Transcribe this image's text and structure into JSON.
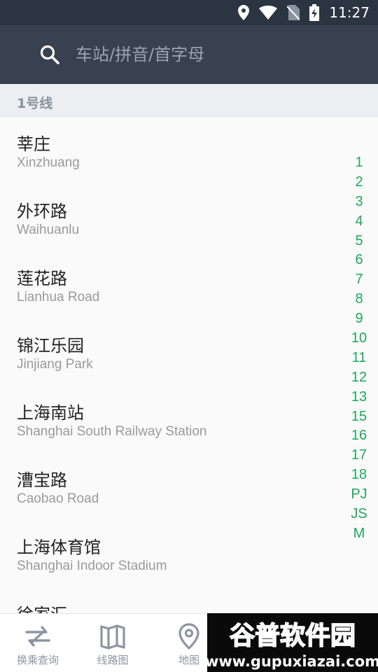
{
  "status_bar": {
    "time": "11:27"
  },
  "search": {
    "placeholder": "车站/拼音/首字母",
    "value": ""
  },
  "section": {
    "title": "1号线"
  },
  "stations": [
    {
      "cn": "莘庄",
      "en": "Xinzhuang"
    },
    {
      "cn": "外环路",
      "en": "Waihuanlu"
    },
    {
      "cn": "莲花路",
      "en": "Lianhua Road"
    },
    {
      "cn": "锦江乐园",
      "en": "Jinjiang Park"
    },
    {
      "cn": "上海南站",
      "en": "Shanghai South Railway Station"
    },
    {
      "cn": "漕宝路",
      "en": "Caobao Road"
    },
    {
      "cn": "上海体育馆",
      "en": "Shanghai Indoor Stadium"
    },
    {
      "cn": "徐家汇",
      "en": ""
    }
  ],
  "index": [
    "1",
    "2",
    "3",
    "4",
    "5",
    "6",
    "7",
    "8",
    "9",
    "10",
    "11",
    "12",
    "13",
    "15",
    "16",
    "17",
    "18",
    "PJ",
    "JS",
    "M"
  ],
  "nav": [
    {
      "label": "换乘查询",
      "icon": "transfer-icon"
    },
    {
      "label": "线路图",
      "icon": "map-book-icon"
    },
    {
      "label": "地图",
      "icon": "location-pin-icon"
    }
  ],
  "watermark": {
    "title": "谷普软件园",
    "url": "www.gupuxiazai.com"
  },
  "colors": {
    "status_bar": "#2b3542",
    "search_bar": "#37414f",
    "index_accent": "#1ea85a",
    "nav_text": "#8d95a0"
  }
}
